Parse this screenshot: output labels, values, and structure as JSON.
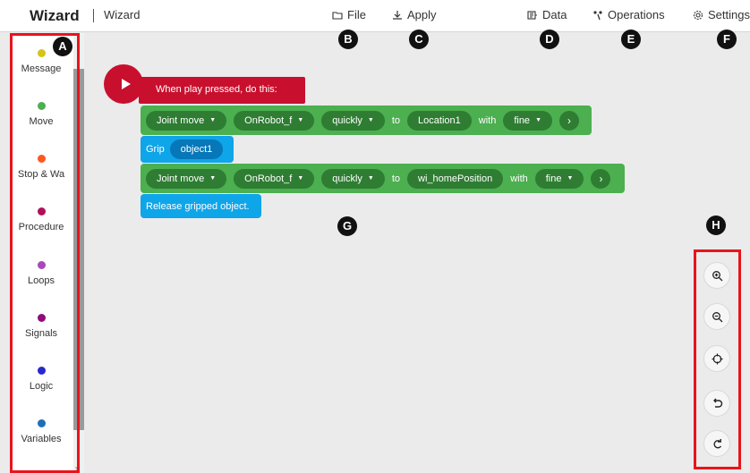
{
  "header": {
    "brand": "Wizard",
    "subtitle": "Wizard",
    "menu": [
      {
        "label": "File",
        "icon": "folder-icon"
      },
      {
        "label": "Apply",
        "icon": "download-icon"
      },
      {
        "label": "Data",
        "icon": "data-icon"
      },
      {
        "label": "Operations",
        "icon": "operations-icon"
      },
      {
        "label": "Settings",
        "icon": "gear-icon"
      }
    ]
  },
  "sidebar": {
    "items": [
      {
        "label": "Message",
        "color": "#d4c41c"
      },
      {
        "label": "Move",
        "color": "#4caf50"
      },
      {
        "label": "Stop & Wa",
        "color": "#ff5722"
      },
      {
        "label": "Procedure",
        "color": "#b0105a"
      },
      {
        "label": "Loops",
        "color": "#ab47bc"
      },
      {
        "label": "Signals",
        "color": "#8e0c7a"
      },
      {
        "label": "Logic",
        "color": "#2828cc"
      },
      {
        "label": "Variables",
        "color": "#1e6fb8"
      }
    ]
  },
  "badges": [
    "A",
    "B",
    "C",
    "D",
    "E",
    "F",
    "G",
    "H"
  ],
  "program": {
    "hat": "When play pressed, do this:",
    "move1": {
      "action": "Joint move",
      "tool": "OnRobot_f",
      "speed": "quickly",
      "to": "to",
      "target": "Location1",
      "with": "with",
      "precision": "fine"
    },
    "grip": {
      "label": "Grip",
      "object": "object1"
    },
    "move2": {
      "action": "Joint move",
      "tool": "OnRobot_f",
      "speed": "quickly",
      "to": "to",
      "target": "wi_homePosition",
      "with": "with",
      "precision": "fine"
    },
    "release": "Release gripped object."
  },
  "zoom": [
    "zoom-in-icon",
    "zoom-out-icon",
    "recenter-icon",
    "undo-icon",
    "redo-icon"
  ],
  "colors": {
    "highlight": "#e8141c",
    "hat": "#c8102e",
    "move": "#4caf50",
    "grip": "#0fa5e9"
  }
}
